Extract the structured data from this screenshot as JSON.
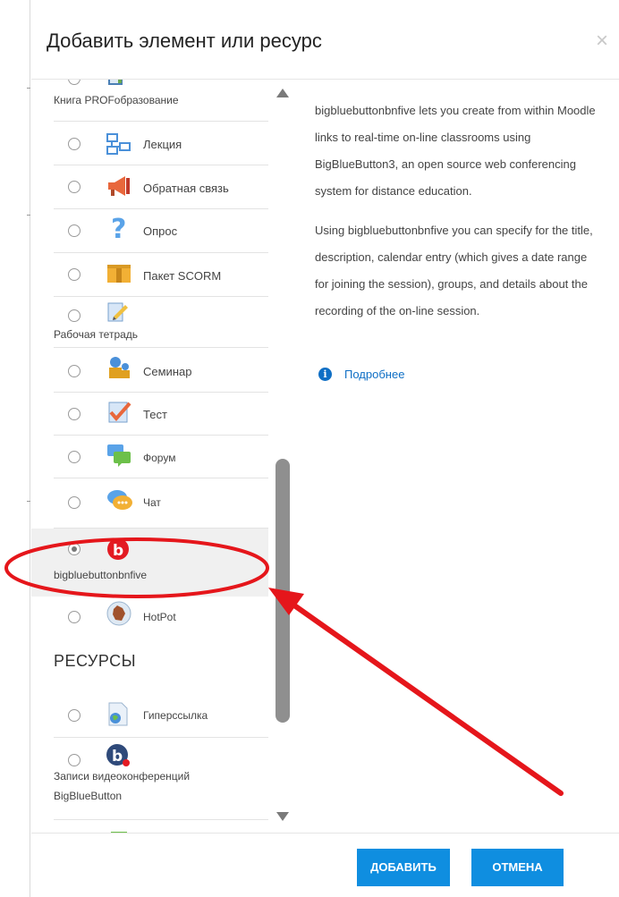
{
  "dialog": {
    "title": "Добавить элемент или ресурс",
    "close_label": "×"
  },
  "activities": [
    {
      "label": "Книга PROFобразование",
      "icon": "book-icon"
    },
    {
      "label": "Лекция",
      "icon": "lesson-icon"
    },
    {
      "label": "Обратная связь",
      "icon": "megaphone-icon"
    },
    {
      "label": "Опрос",
      "icon": "question-icon"
    },
    {
      "label": "Пакет SCORM",
      "icon": "package-icon"
    },
    {
      "label": "Рабочая тетрадь",
      "icon": "notebook-icon"
    },
    {
      "label": "Семинар",
      "icon": "workshop-icon"
    },
    {
      "label": "Тест",
      "icon": "quiz-icon"
    },
    {
      "label": "Форум",
      "icon": "forum-icon"
    },
    {
      "label": "Чат",
      "icon": "chat-icon"
    },
    {
      "label": "bigbluebuttonbnfive",
      "icon": "bigbluebutton-icon",
      "selected": true
    },
    {
      "label": "HotPot",
      "icon": "hotpot-icon"
    }
  ],
  "resources_heading": "РЕСУРСЫ",
  "resources": [
    {
      "label": "Гиперссылка",
      "icon": "url-icon"
    },
    {
      "label": "Записи видеоконференций BigBlueButton",
      "label_line1": "Записи видеоконференций",
      "label_line2": "BigBlueButton",
      "icon": "recordings-icon"
    }
  ],
  "description": {
    "paragraph1": "bigbluebuttonbnfive lets you create from within Moodle links to real-time on-line classrooms using BigBlueButton3, an open source web conferencing system for distance education.",
    "paragraph2": "Using bigbluebuttonbnfive you can specify for the title, description, calendar entry (which gives a date range for joining the session), groups, and details about the recording of the on-line session.",
    "more_link": "Подробнее"
  },
  "footer": {
    "add_label": "ДОБАВИТЬ",
    "cancel_label": "ОТМЕНА"
  },
  "colors": {
    "primary_button": "#0f8ee0",
    "link": "#0f6fc5",
    "annotation": "#e5161b"
  }
}
